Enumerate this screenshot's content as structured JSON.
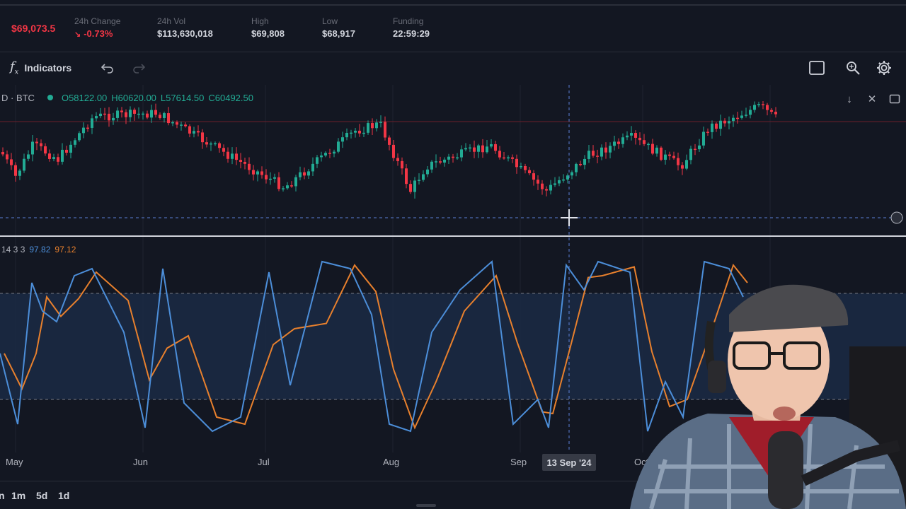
{
  "ticker": {
    "last_price": "$69,073.5",
    "change_label": "24h Change",
    "change_value": "-0.73%",
    "vol_label": "24h Vol",
    "vol_value": "$113,630,018",
    "high_label": "High",
    "high_value": "$69,808",
    "low_label": "Low",
    "low_value": "$68,917",
    "funding_label": "Funding",
    "funding_value": "22:59:29"
  },
  "toolbar": {
    "indicators_label": "Indicators",
    "icons": [
      "function-icon",
      "undo-icon",
      "redo-icon",
      "rectangle-icon",
      "zoom-icon",
      "gear-icon"
    ]
  },
  "price_pane": {
    "symbol": "D · BTC",
    "open": "O58122.00",
    "high": "H60620.00",
    "low": "L57614.50",
    "close": "C60492.50",
    "controls": [
      "down-arrow-icon",
      "collapse-icon",
      "maximize-icon"
    ]
  },
  "oscillator": {
    "params": "14 3 3",
    "k_value": "97.82",
    "d_value": "97.12"
  },
  "x_axis": {
    "labels": [
      "May",
      "Jun",
      "Jul",
      "Aug",
      "Sep",
      "Oct"
    ],
    "crosshair_date": "13 Sep '24"
  },
  "ranges": [
    "1m",
    "5d",
    "1d"
  ],
  "colors": {
    "background": "#131722",
    "up": "#22ab94",
    "down": "#f23645",
    "stoch_k": "#4c8ed9",
    "stoch_d": "#e8802d"
  }
}
